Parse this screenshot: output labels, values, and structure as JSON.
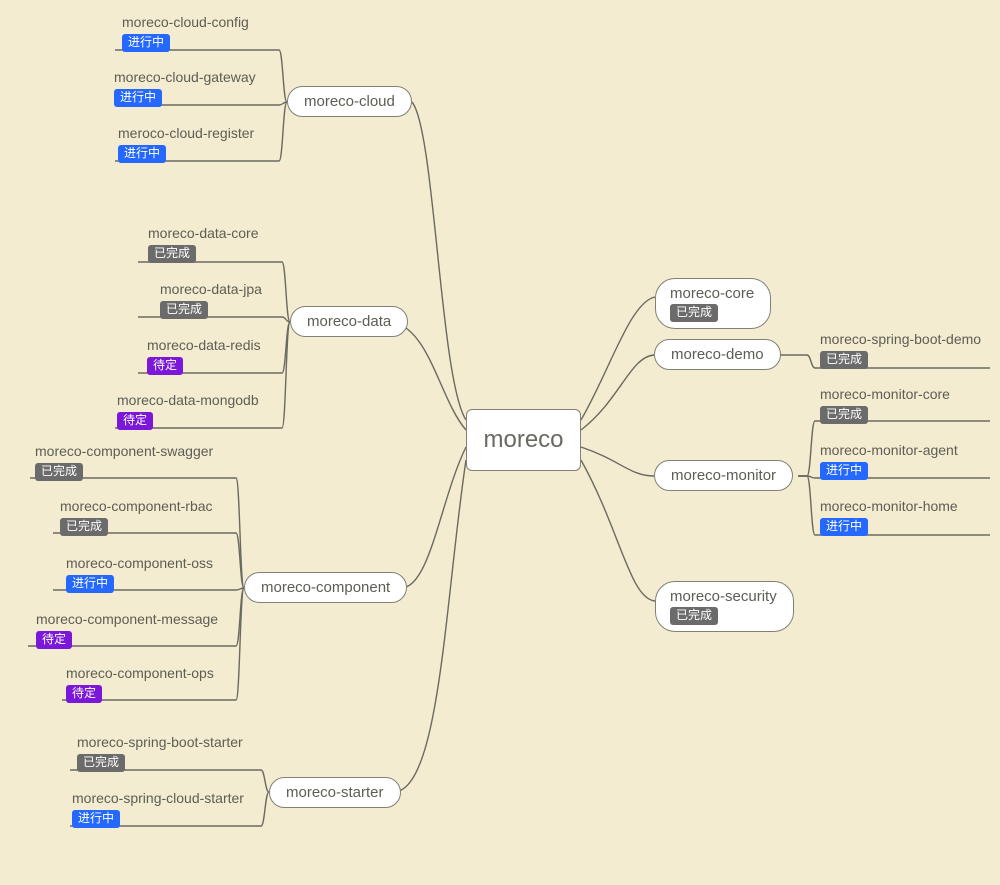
{
  "root": {
    "label": "moreco"
  },
  "tags": {
    "done": "已完成",
    "progress": "进行中",
    "pending": "待定"
  },
  "left_branches": {
    "cloud": {
      "label": "moreco-cloud",
      "children": [
        {
          "label": "moreco-cloud-config",
          "status": "progress"
        },
        {
          "label": "moreco-cloud-gateway",
          "status": "progress"
        },
        {
          "label": "meroco-cloud-register",
          "status": "progress"
        }
      ]
    },
    "data": {
      "label": "moreco-data",
      "children": [
        {
          "label": "moreco-data-core",
          "status": "done"
        },
        {
          "label": "moreco-data-jpa",
          "status": "done"
        },
        {
          "label": "moreco-data-redis",
          "status": "pending"
        },
        {
          "label": "moreco-data-mongodb",
          "status": "pending"
        }
      ]
    },
    "component": {
      "label": "moreco-component",
      "children": [
        {
          "label": "moreco-component-swagger",
          "status": "done"
        },
        {
          "label": "moreco-component-rbac",
          "status": "done"
        },
        {
          "label": "moreco-component-oss",
          "status": "progress"
        },
        {
          "label": "moreco-component-message",
          "status": "pending"
        },
        {
          "label": "moreco-component-ops",
          "status": "pending"
        }
      ]
    },
    "starter": {
      "label": "moreco-starter",
      "children": [
        {
          "label": "moreco-spring-boot-starter",
          "status": "done"
        },
        {
          "label": "moreco-spring-cloud-starter",
          "status": "progress"
        }
      ]
    }
  },
  "right_branches": {
    "core": {
      "label": "moreco-core",
      "status": "done"
    },
    "demo": {
      "label": "moreco-demo",
      "children": [
        {
          "label": "moreco-spring-boot-demo",
          "status": "done"
        }
      ]
    },
    "monitor": {
      "label": "moreco-monitor",
      "children": [
        {
          "label": "moreco-monitor-core",
          "status": "done"
        },
        {
          "label": "moreco-monitor-agent",
          "status": "progress"
        },
        {
          "label": "moreco-monitor-home",
          "status": "progress"
        }
      ]
    },
    "security": {
      "label": "moreco-security",
      "status": "done"
    }
  }
}
